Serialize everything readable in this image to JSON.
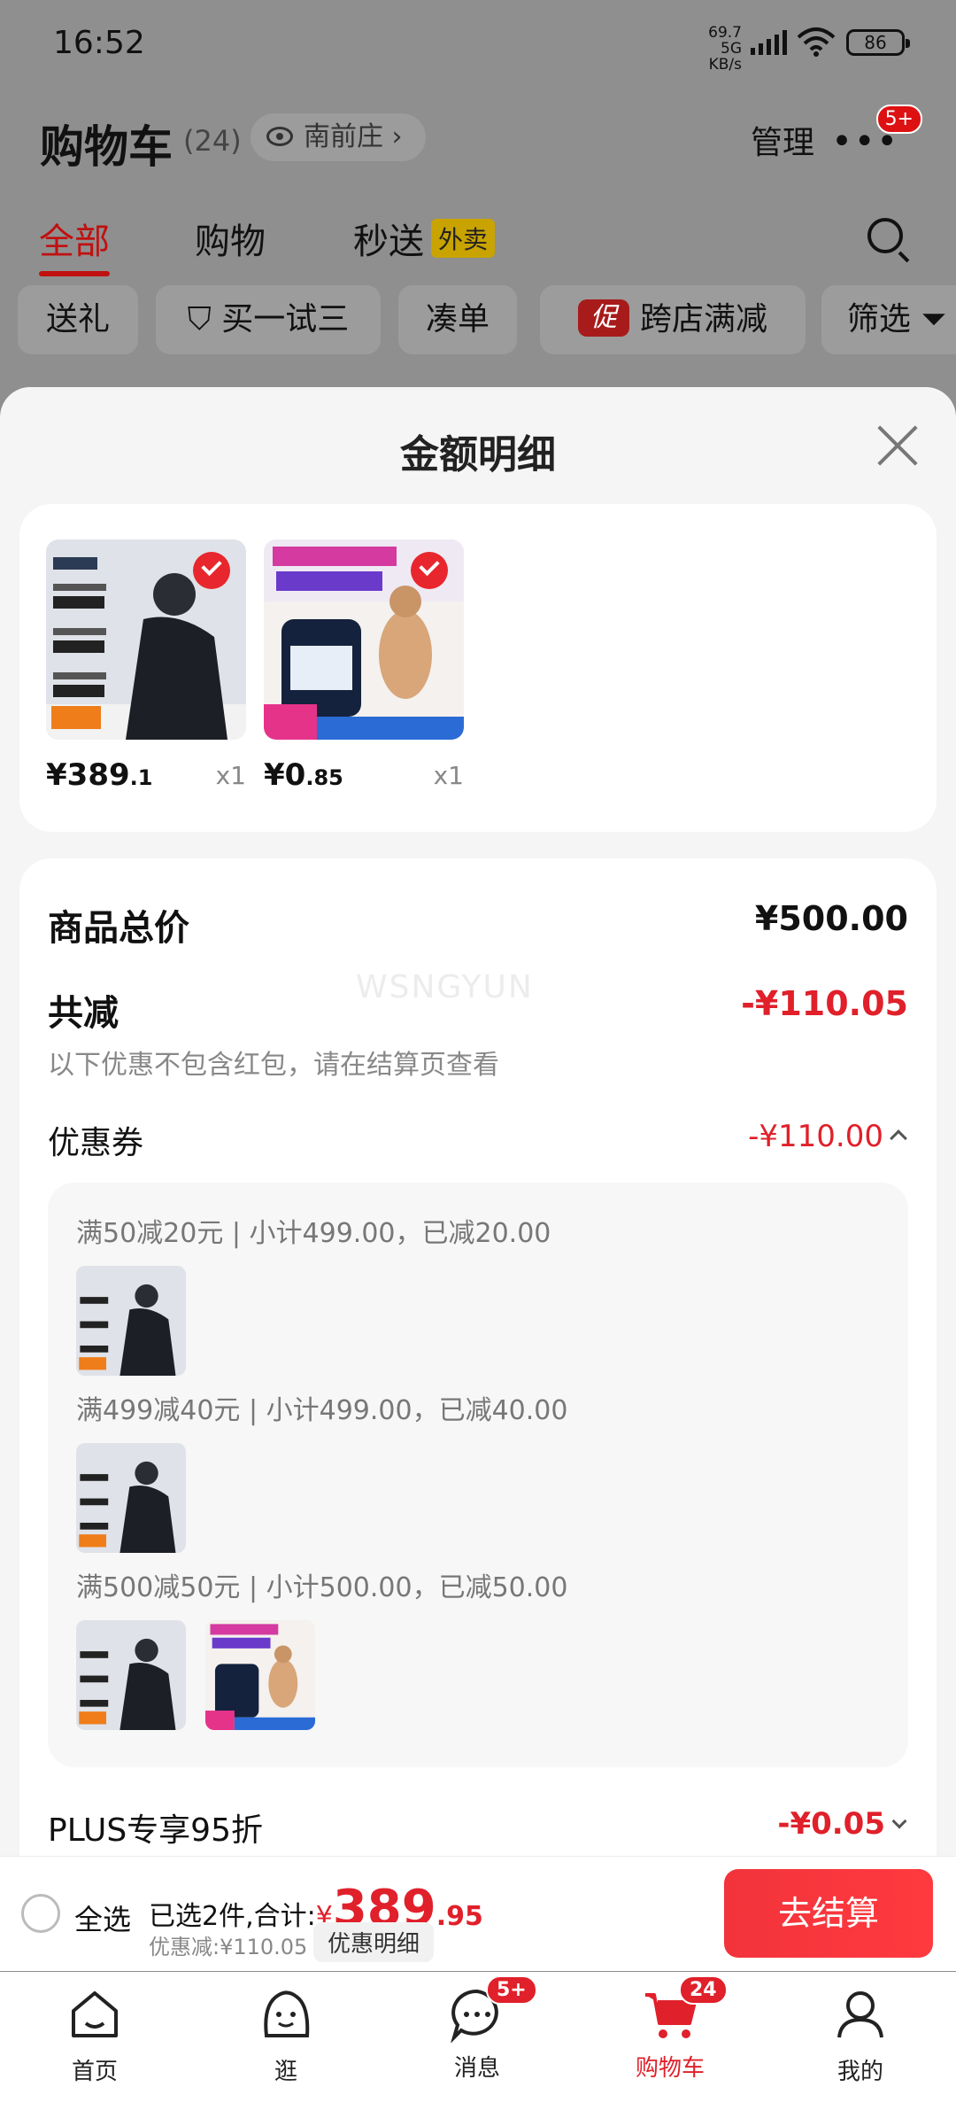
{
  "status_bar": {
    "time": "16:52",
    "net_speed": "69.7",
    "net_unit": "KB/s",
    "net_type": "5G",
    "battery": "86"
  },
  "header": {
    "title": "购物车",
    "count": "(24)",
    "location": "南前庄",
    "manage": "管理",
    "more_badge": "5+"
  },
  "tabs": [
    {
      "label": "全部",
      "active": true
    },
    {
      "label": "购物",
      "active": false
    },
    {
      "label": "秒送",
      "tag": "外卖",
      "active": false
    }
  ],
  "chips": [
    "送礼",
    "买一试三",
    "凑单",
    "跨店满减",
    "筛选"
  ],
  "chip_tag": "促",
  "modal": {
    "title": "金额明细",
    "products": [
      {
        "price_int": "¥389",
        "price_dec": ".1",
        "qty": "x1",
        "image": "jacket-product-image"
      },
      {
        "price_int": "¥0",
        "price_dec": ".85",
        "qty": "x1",
        "image": "supplement-product-image"
      }
    ],
    "total_label": "商品总价",
    "total_value": "¥500.00",
    "discount_label": "共减",
    "discount_value": "-¥110.05",
    "discount_hint": "以下优惠不包含红包，请在结算页查看",
    "watermark": "WSNGYUN",
    "coupon_label": "优惠券",
    "coupon_value": "-¥110.00",
    "coupon_rules": [
      "满50减20元 | 小计499.00，已减20.00",
      "满499减40元 | 小计499.00，已减40.00",
      "满500减50元 | 小计500.00，已减50.00"
    ],
    "plus_label": "PLUS专享95折",
    "plus_value": "-¥0.05"
  },
  "checkout": {
    "select_all": "全选",
    "summary_prefix": "已选2件,合计:",
    "yen": "¥",
    "total_int": "389",
    "total_dec": ".95",
    "discount": "优惠减:¥110.05",
    "detail_button": "优惠明细",
    "pay_button": "去结算"
  },
  "bottom_nav": [
    {
      "label": "首页",
      "icon": "home-icon"
    },
    {
      "label": "逛",
      "icon": "browse-icon"
    },
    {
      "label": "消息",
      "icon": "message-icon",
      "badge": "5+"
    },
    {
      "label": "购物车",
      "icon": "cart-icon",
      "badge": "24",
      "active": true
    },
    {
      "label": "我的",
      "icon": "profile-icon"
    }
  ],
  "colors": {
    "accent": "#e0202a",
    "dim_overlay": "#8f8f8f",
    "sheet_bg": "#f5f5f5"
  }
}
